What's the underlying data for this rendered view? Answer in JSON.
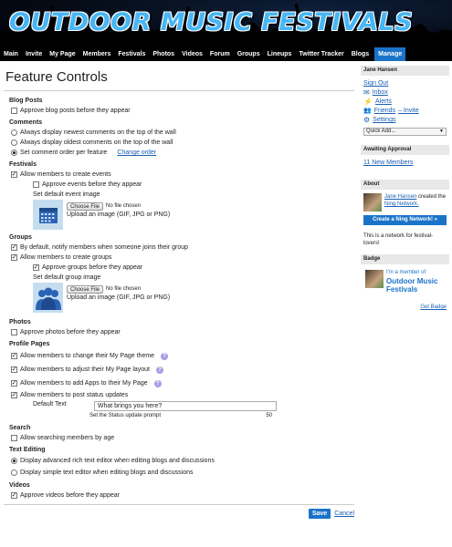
{
  "site": {
    "title": "OUTDOOR MUSIC FESTIVALS"
  },
  "nav": [
    "Main",
    "Invite",
    "My Page",
    "Members",
    "Festivals",
    "Photos",
    "Videos",
    "Forum",
    "Groups",
    "Lineups",
    "Twitter Tracker",
    "Blogs",
    "Manage"
  ],
  "page": {
    "title": "Feature Controls"
  },
  "blog_posts": {
    "heading": "Blog Posts",
    "approve": "Approve blog posts before they appear"
  },
  "comments": {
    "heading": "Comments",
    "opt1": "Always display newest comments on the top of the wall",
    "opt2": "Always display oldest comments on the top of the wall",
    "opt3": "Set comment order per feature",
    "change_order": "Change order"
  },
  "festivals": {
    "heading": "Festivals",
    "allow": "Allow members to create events",
    "approve": "Approve events before they appear",
    "default_image": "Set default event image"
  },
  "upload": {
    "choose": "Choose File",
    "none": "No file chosen",
    "hint": "Upload an image (GIF, JPG or PNG)"
  },
  "groups": {
    "heading": "Groups",
    "notify": "By default, notify members when someone joins their group",
    "allow": "Allow members to create groups",
    "approve": "Approve groups before they appear",
    "default_image": "Set default group image"
  },
  "photos": {
    "heading": "Photos",
    "approve": "Approve photos before they appear"
  },
  "profile": {
    "heading": "Profile Pages",
    "theme": "Allow members to change their My Page theme",
    "layout": "Allow members to adjust their My Page layout",
    "apps": "Allow members to add Apps to their My Page",
    "status": "Allow members to post status updates",
    "default_text_label": "Default Text",
    "default_text_value": "What brings you here?",
    "status_hint": "Set the Status update prompt",
    "status_max": "50"
  },
  "search": {
    "heading": "Search",
    "allow": "Allow searching members by age"
  },
  "text_editing": {
    "heading": "Text Editing",
    "rich": "Display advanced rich text editor when editing blogs and discussions",
    "simple": "Display simple text editor when editing blogs and discussions"
  },
  "videos": {
    "heading": "Videos",
    "approve": "Approve videos before they appear"
  },
  "actions": {
    "save": "Save",
    "cancel": "Cancel"
  },
  "sidebar": {
    "user": "Jane Hansen",
    "sign_out": "Sign Out",
    "inbox": "Inbox",
    "alerts": "Alerts",
    "friends": "Friends",
    "friends_invite": "– Invite",
    "settings": "Settings",
    "quick_add": "Quick Add...",
    "awaiting_head": "Awaiting Approval",
    "new_members": "11 New Members",
    "about_head": "About",
    "about_name": "Jane Hansen",
    "about_created": " created the ",
    "about_network": "Ning Network.",
    "create_btn": "Create a Ning Network! »",
    "about_text": "This is a network for festival-lovers!",
    "badge_head": "Badge",
    "badge_member": "I'm a member of",
    "badge_title": "Outdoor Music Festivals",
    "get_badge": "Get Badge"
  }
}
